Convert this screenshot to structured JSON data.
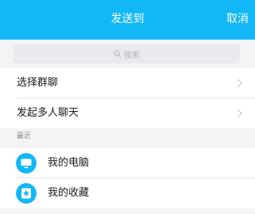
{
  "header": {
    "title": "发送到",
    "cancel_label": "取消"
  },
  "search": {
    "placeholder": "搜索",
    "icon": "search-icon"
  },
  "actions": [
    {
      "label": "选择群聊",
      "icon": "chevron-right-icon"
    },
    {
      "label": "发起多人聊天",
      "icon": "chevron-right-icon"
    }
  ],
  "recent": {
    "section_label": "最近",
    "items": [
      {
        "label": "我的电脑",
        "icon": "computer-icon",
        "color": "#12b7f5"
      },
      {
        "label": "我的收藏",
        "icon": "favorites-icon",
        "color": "#12b7f5"
      }
    ]
  },
  "colors": {
    "accent": "#12b7f5",
    "background": "#f4f4f6"
  }
}
